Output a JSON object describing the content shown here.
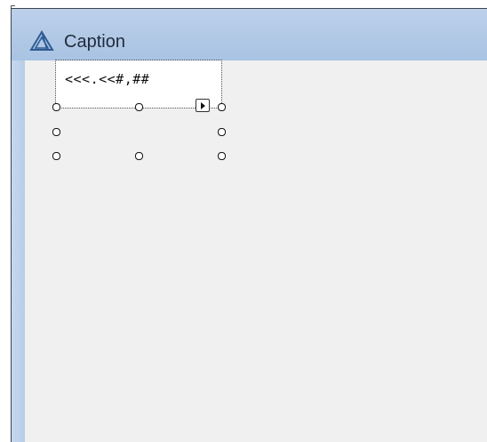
{
  "window": {
    "title": "Caption",
    "icon": "app-logo-icon"
  },
  "control": {
    "text": "<<<.<<#,##",
    "smart_tag_icon": "smart-tag-arrow-icon"
  },
  "colors": {
    "titlebar": "#a9c3e3",
    "client_background": "#f0f0f0",
    "control_background": "#ffffff"
  }
}
